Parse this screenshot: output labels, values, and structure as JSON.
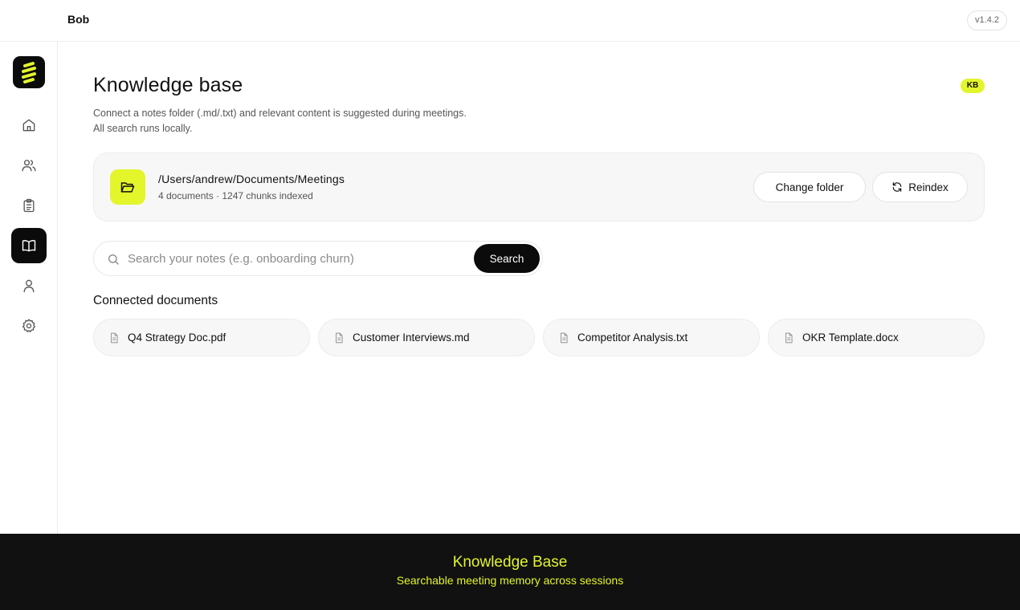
{
  "topbar": {
    "app_name": "Bob",
    "version": "v1.4.2"
  },
  "sidebar": {
    "logo": "bob-logo-icon",
    "items": [
      {
        "name": "home",
        "icon": "home-icon",
        "active": false
      },
      {
        "name": "people",
        "icon": "users-icon",
        "active": false
      },
      {
        "name": "tasks",
        "icon": "clipboard-icon",
        "active": false
      },
      {
        "name": "knowledge-base",
        "icon": "book-open-icon",
        "active": true
      },
      {
        "name": "profile",
        "icon": "user-icon",
        "active": false
      },
      {
        "name": "settings",
        "icon": "gear-icon",
        "active": false
      }
    ]
  },
  "main": {
    "title": "Knowledge base",
    "badge": "KB",
    "description_line1": "Connect a notes folder (.md/.txt) and relevant content is suggested during meetings.",
    "description_line2": "All search runs locally.",
    "folder": {
      "path": "/Users/andrew/Documents/Meetings",
      "stats": "4 documents · 1247 chunks indexed",
      "change_label": "Change folder",
      "reindex_label": "Reindex"
    },
    "search": {
      "placeholder": "Search your notes (e.g. onboarding churn)",
      "value": "",
      "button_label": "Search"
    },
    "documents_title": "Connected documents",
    "documents": [
      {
        "name": "Q4 Strategy Doc.pdf"
      },
      {
        "name": "Customer Interviews.md"
      },
      {
        "name": "Competitor Analysis.txt"
      },
      {
        "name": "OKR Template.docx"
      }
    ]
  },
  "footer": {
    "title": "Knowledge Base",
    "subtitle": "Searchable meeting memory across sessions"
  },
  "colors": {
    "accent": "#e3f52b",
    "dark": "#0b0b0b",
    "card_bg": "#f7f7f7",
    "border": "#ececec"
  }
}
